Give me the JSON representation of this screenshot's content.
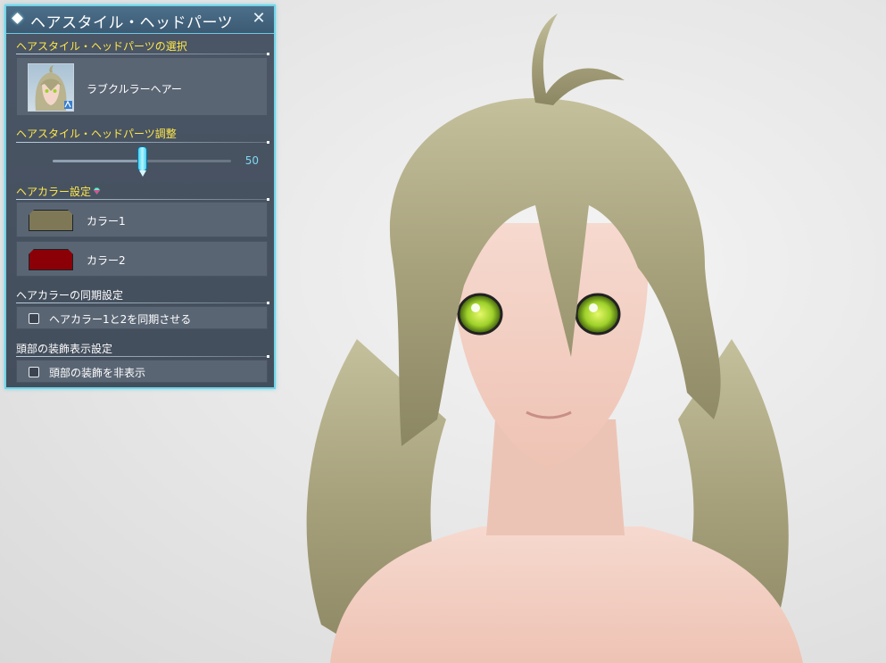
{
  "window": {
    "title": "ヘアスタイル・ヘッドパーツ",
    "close_symbol": "✕"
  },
  "sections": {
    "select_heading": "ヘアスタイル・ヘッドパーツの選択",
    "adjust_heading": "ヘアスタイル・ヘッドパーツ調整",
    "color_heading": "ヘアカラー設定",
    "sync_heading": "ヘアカラーの同期設定",
    "decor_heading": "頭部の装飾表示設定"
  },
  "hairstyle": {
    "name": "ラブクルラーヘアー"
  },
  "slider": {
    "value": "50",
    "level": 0.5
  },
  "colors": [
    {
      "label": "カラー1",
      "hex": "#7f7856"
    },
    {
      "label": "カラー2",
      "hex": "#8a0006"
    }
  ],
  "sync_option": {
    "label": "ヘアカラー1と2を同期させる",
    "checked": false
  },
  "decor_option": {
    "label": "頭部の装飾を非表示",
    "checked": false
  },
  "theme": {
    "accent": "#6fd6ea",
    "heading_yellow": "#ffe84a",
    "hair_color": "#a9a47c",
    "eye_color": "#9ed12a"
  }
}
